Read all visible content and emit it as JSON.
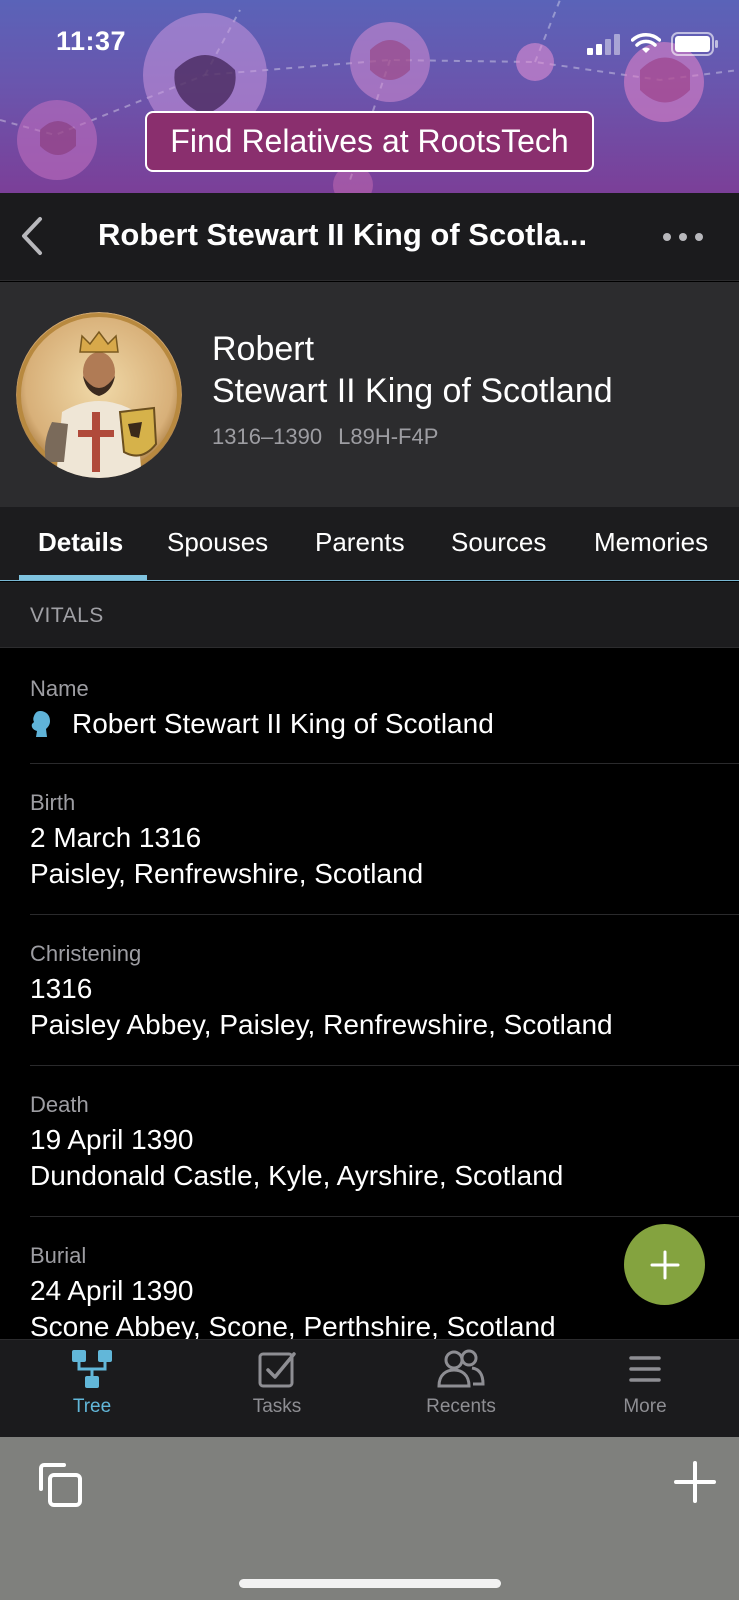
{
  "status_bar": {
    "time": "11:37"
  },
  "banner": {
    "cta_label": "Find Relatives at RootsTech"
  },
  "nav": {
    "title": "Robert Stewart II King of Scotla..."
  },
  "person": {
    "given_name": "Robert",
    "surname": "Stewart II King of Scotland",
    "lifespan": "1316–1390",
    "person_id": "L89H-F4P"
  },
  "tabs": [
    "Details",
    "Spouses",
    "Parents",
    "Sources",
    "Memories"
  ],
  "section": {
    "title": "VITALS"
  },
  "vitals": {
    "name": {
      "label": "Name",
      "value": "Robert Stewart II King of Scotland"
    },
    "birth": {
      "label": "Birth",
      "date": "2 March 1316",
      "place": "Paisley, Renfrewshire, Scotland"
    },
    "christening": {
      "label": "Christening",
      "date": "1316",
      "place": "Paisley Abbey, Paisley, Renfrewshire, Scotland"
    },
    "death": {
      "label": "Death",
      "date": "19 April 1390",
      "place": "Dundonald Castle, Kyle, Ayrshire, Scotland"
    },
    "burial": {
      "label": "Burial",
      "date": "24 April 1390",
      "place": "Scone Abbey, Scone, Perthshire, Scotland"
    }
  },
  "tabbar": {
    "items": [
      {
        "label": "Tree",
        "icon": "tree-icon",
        "active": true
      },
      {
        "label": "Tasks",
        "icon": "tasks-icon",
        "active": false
      },
      {
        "label": "Recents",
        "icon": "recents-icon",
        "active": false
      },
      {
        "label": "More",
        "icon": "menu-icon",
        "active": false
      }
    ]
  },
  "colors": {
    "accent": "#62b7d9",
    "fab": "#84a33f",
    "cta_background": "#8a2f6e"
  }
}
